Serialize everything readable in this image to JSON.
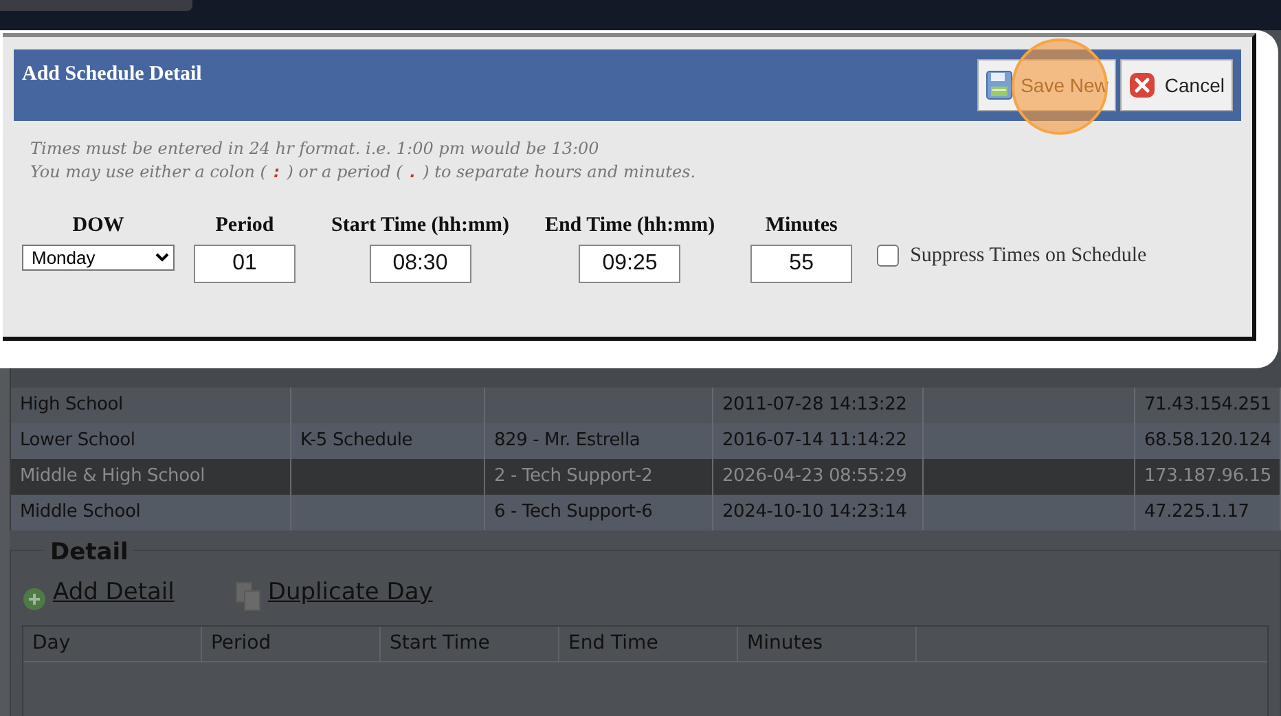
{
  "dialog": {
    "title": "Add Schedule Detail",
    "buttons": [
      {
        "label": "Save New",
        "kind": "save",
        "highlighted": true
      },
      {
        "label": "Cancel",
        "kind": "cancel",
        "highlighted": false
      }
    ],
    "notes": [
      "Times must be entered in 24 hr format. i.e. 1:00 pm would be 13:00",
      "You may use either a colon ( **:** ) or a period ( **.** ) to separate hours and minutes."
    ],
    "fields": [
      {
        "kind": "select",
        "label": "DOW",
        "value": "Monday"
      },
      {
        "kind": "input",
        "label": "Period",
        "value": "01"
      },
      {
        "kind": "input",
        "label": "Start Time (hh:mm)",
        "value": "08:30"
      },
      {
        "kind": "input",
        "label": "End Time (hh:mm)",
        "value": "09:25"
      },
      {
        "kind": "input",
        "label": "Minutes",
        "value": "55"
      }
    ],
    "suppress": {
      "label": "Suppress Times on Schedule",
      "checked": false
    }
  },
  "schedules": {
    "rows": [
      {
        "cells": [
          "High School",
          "",
          "",
          "2011-07-28 14:13:22",
          "",
          "71.43.154.251"
        ],
        "selected": false
      },
      {
        "cells": [
          "Lower School",
          "K-5 Schedule",
          "829 - Mr. Estrella",
          "2016-07-14 11:14:22",
          "",
          "68.58.120.124"
        ],
        "selected": false
      },
      {
        "cells": [
          "Middle & High School",
          "",
          "2 - Tech Support-2",
          "2026-04-23 08:55:29",
          "",
          "173.187.96.15"
        ],
        "selected": true
      },
      {
        "cells": [
          "Middle School",
          "",
          "6 - Tech Support-6",
          "2024-10-10 14:23:14",
          "",
          "47.225.1.17"
        ],
        "selected": false
      }
    ]
  },
  "detail": {
    "legend": "Detail",
    "actions": [
      {
        "label": "Add Detail",
        "kind": "add"
      },
      {
        "label": "Duplicate Day",
        "kind": "duplicate"
      }
    ],
    "columns": [
      "Day",
      "Period",
      "Start Time",
      "End Time",
      "Minutes"
    ]
  }
}
